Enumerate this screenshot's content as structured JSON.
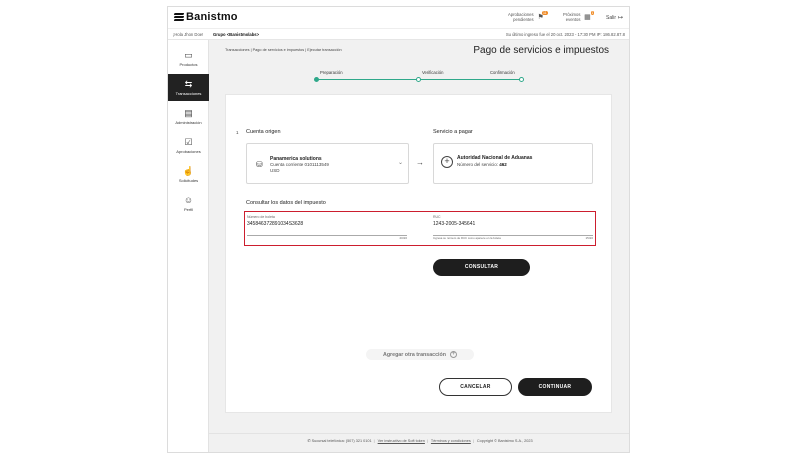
{
  "app": {
    "brand": "Banistmo"
  },
  "header": {
    "approvals_label_1": "Aprobaciones",
    "approvals_label_2": "pendientes",
    "approvals_count": "11",
    "events_label_1": "Próximos",
    "events_label_2": "eventos",
    "events_count": "1",
    "logout_label": "Salir"
  },
  "greeting": {
    "hello": "¡Hola Jhon Doe!",
    "group": "Grupo <Banistmolabs>",
    "last_login": "Su último ingreso fue el 20 oct. 2023 - 17:30 PM IP: 186.82.87.8"
  },
  "sidebar": {
    "items": [
      {
        "label": "Productos",
        "icon": "card-icon"
      },
      {
        "label": "Transacciones",
        "icon": "transfer-arrows-icon"
      },
      {
        "label": "Administración",
        "icon": "document-gear-icon"
      },
      {
        "label": "Aprobaciones",
        "icon": "checkbox-icon"
      },
      {
        "label": "Solicitudes",
        "icon": "hand-click-icon"
      },
      {
        "label": "Perfil",
        "icon": "user-icon"
      }
    ]
  },
  "breadcrumb": "Transacciones | Pago de servicios e impuestos | Ejecutar transacción",
  "page_title": "Pago de servicios e impuestos",
  "stepper": {
    "steps": [
      "Preparación",
      "Verificación",
      "Confirmación"
    ]
  },
  "form": {
    "step_number": "1",
    "origin_title": "Cuenta origen",
    "origin": {
      "name": "Panamerica solutions",
      "account": "Cuenta corriente 0101113549",
      "currency": "USD"
    },
    "service_title": "Servicio a pagar",
    "service": {
      "name": "Autoridad Nacional de Aduanas",
      "number_label": "Número del servicio:",
      "number": "462"
    },
    "tax_title": "Consultar los datos del impuesto",
    "ballot": {
      "label": "Número de boleta",
      "value": "345846372891034S3628",
      "count": "20/20"
    },
    "ruc": {
      "label": "RUC",
      "value": "1243-2005-345641",
      "hint": "Ingresa su número de RUC como aparece en la boleta",
      "count": "15/20"
    },
    "consult_label": "CONSULTAR",
    "add_transaction_label": "Agregar otra transacción",
    "cancel_label": "CANCELAR",
    "continue_label": "CONTINUAR"
  },
  "footer": {
    "phone": "Sucursal telefónica: (507) 321 0101",
    "soft_token": "Ver instructivo de Soft token",
    "terms": "Términos y condiciones",
    "copyright": "Copyright © Banistmo S.A., 2023"
  },
  "colors": {
    "accent": "#2fa88a",
    "highlight": "#cc1e2e",
    "dark": "#1e1e1e"
  }
}
